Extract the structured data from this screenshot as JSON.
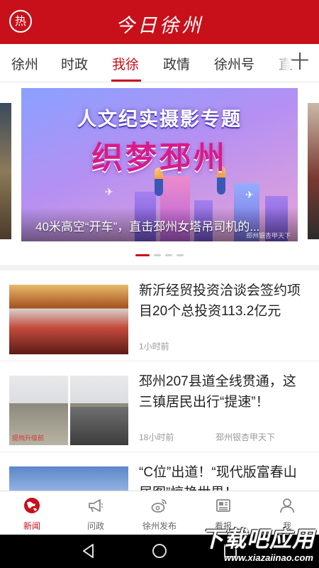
{
  "colors": {
    "brand": "#c8101a",
    "tab_active": "#c8101a",
    "text": "#222222",
    "meta": "#999999"
  },
  "header": {
    "hot_label": "热",
    "title": "今日徐州"
  },
  "tabs": [
    {
      "label": "徐州",
      "active": false
    },
    {
      "label": "时政",
      "active": false
    },
    {
      "label": "我徐",
      "active": true
    },
    {
      "label": "政情",
      "active": false
    },
    {
      "label": "徐州号",
      "active": false
    },
    {
      "label": "直",
      "active": false
    }
  ],
  "tabs_add_label": "十",
  "carousel": {
    "slide": {
      "topic": "人文纪实摄影专题",
      "headline": "织梦邳州",
      "caption": "40米高空“开车”，直击邳州女塔吊司机的...",
      "watermark": "邳州银杏甲天下"
    },
    "slide_count": 4,
    "active_index": 0
  },
  "news": [
    {
      "title": "新沂经贸投资洽谈会签约项目20个总投资113.2亿元",
      "time": "1小时前",
      "source": ""
    },
    {
      "title": "邳州207县道全线贯通，这三镇居民出行“提速”！",
      "time": "18小时前",
      "source": "邳州银杏甲天下",
      "image_tag": "提档升级前"
    },
    {
      "title": "“C位”出道！“现代版富春山居图”惊艳世界！",
      "time": "",
      "source": ""
    }
  ],
  "bottom_nav": [
    {
      "label": "新闻",
      "icon": "globe-icon",
      "active": true
    },
    {
      "label": "问政",
      "icon": "megaphone-icon",
      "active": false
    },
    {
      "label": "徐州发布",
      "icon": "weibo-icon",
      "active": false
    },
    {
      "label": "看报",
      "icon": "newspaper-icon",
      "active": false
    },
    {
      "label": "我",
      "icon": "user-icon",
      "active": false
    }
  ],
  "watermark": {
    "main": "下载吧应用",
    "url": "www.xiazaiinao.com"
  }
}
